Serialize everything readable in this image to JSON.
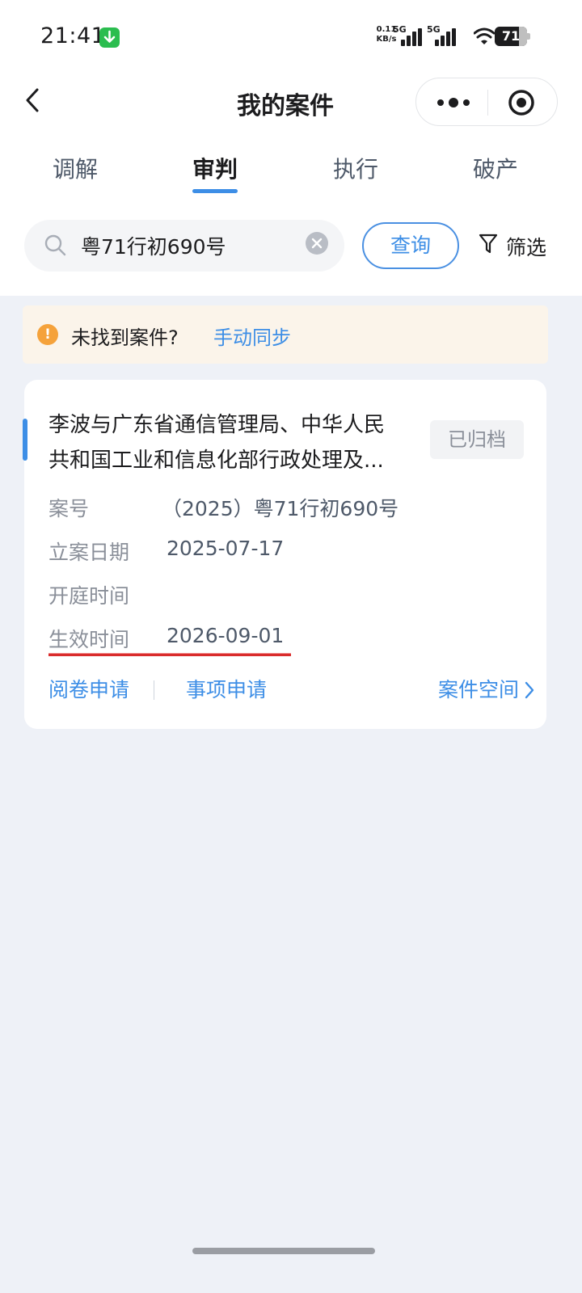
{
  "status_bar": {
    "time": "21:41",
    "net_speed_value": "0.11",
    "net_speed_unit": "KB/s",
    "signal1_tag": "5G",
    "signal2_tag": "5G",
    "battery": "71",
    "icons": [
      "download-badge-icon",
      "signal-icon",
      "wifi-icon",
      "battery-icon"
    ]
  },
  "nav": {
    "title": "我的案件",
    "back_icon": "chevron-left-icon",
    "more_icon": "more-dots-icon",
    "close_icon": "target-close-icon"
  },
  "tabs": [
    {
      "label": "调解",
      "active": false
    },
    {
      "label": "审判",
      "active": true
    },
    {
      "label": "执行",
      "active": false
    },
    {
      "label": "破产",
      "active": false
    }
  ],
  "search": {
    "value": "粤71行初690号",
    "query_label": "查询",
    "filter_label": "筛选"
  },
  "notice": {
    "message": "未找到案件?",
    "link": "手动同步"
  },
  "card": {
    "title": "李波与广东省通信管理局、中华人民共和国工业和信息化部行政处理及...",
    "title_line1": "李波与广东省通信管理局、中华人民",
    "title_line2": "共和国工业和信息化部行政处理及...",
    "status": "已归档",
    "fields": [
      {
        "label": "案号",
        "value": "（2025）粤71行初690号"
      },
      {
        "label": "立案日期",
        "value": "2025-07-17"
      },
      {
        "label": "开庭时间",
        "value": ""
      },
      {
        "label": "生效时间",
        "value": "2026-09-01"
      }
    ],
    "actions": {
      "read_file": "阅卷申请",
      "matter_apply": "事项申请",
      "case_space": "案件空间"
    }
  },
  "colors": {
    "accent": "#3d8ee6",
    "background": "#eef1f7",
    "notice_bg": "#fbf4ea",
    "warning": "#f5a23b",
    "underline_red": "#d92c2c"
  }
}
